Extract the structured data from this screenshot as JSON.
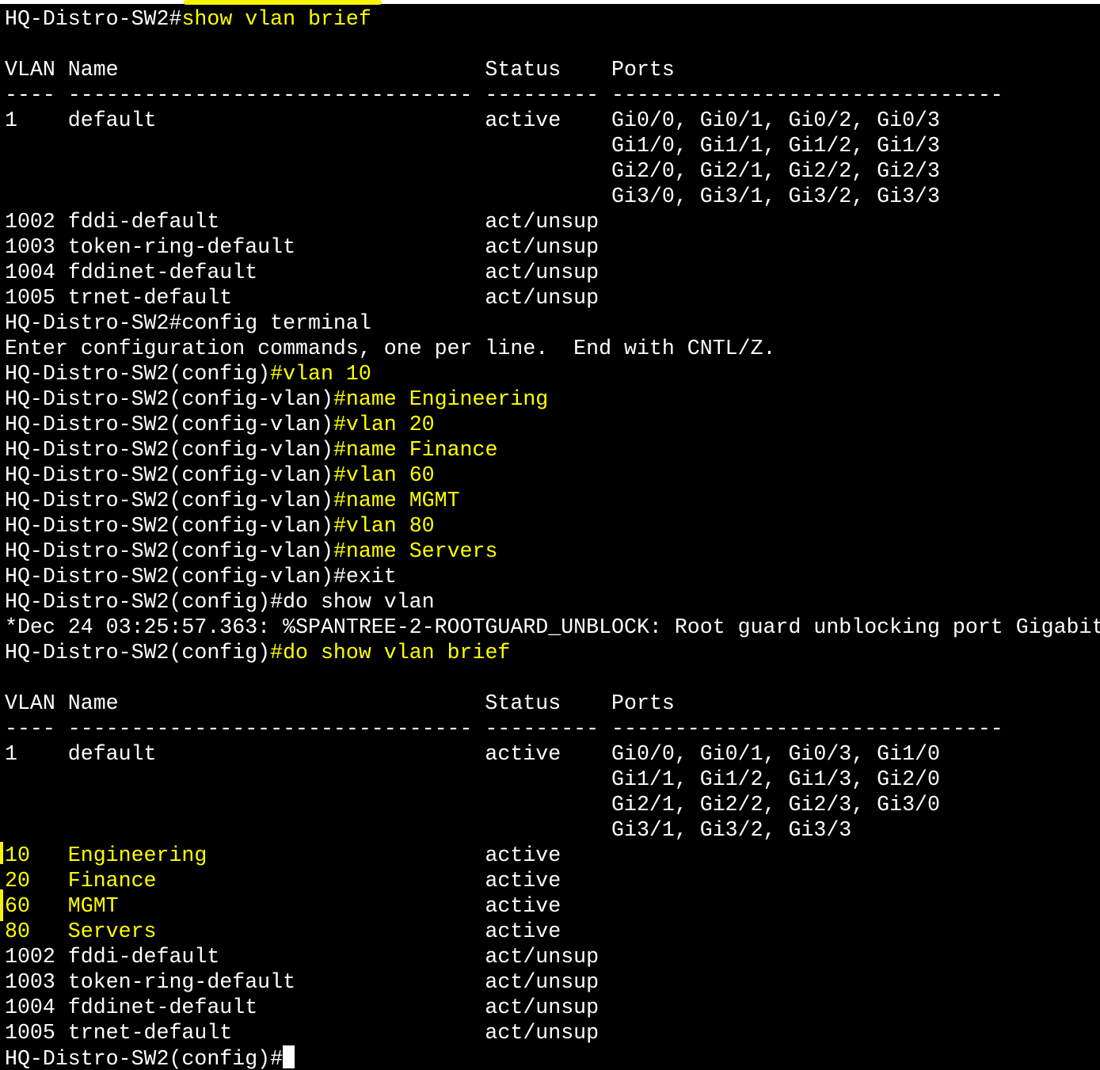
{
  "colors": {
    "background": "#000000",
    "text": "#ffffff",
    "highlight": "#ffff00",
    "annotation": "#f5f500"
  },
  "terminal": {
    "lines": [
      {
        "segments": [
          {
            "t": "HQ-Distro-SW2#",
            "c": "w"
          },
          {
            "t": "show vlan brief",
            "c": "y"
          }
        ]
      },
      {
        "segments": []
      },
      {
        "segments": [
          {
            "t": "VLAN Name                             Status    Ports",
            "c": "w"
          }
        ]
      },
      {
        "segments": [
          {
            "t": "---- -------------------------------- --------- -------------------------------",
            "c": "w"
          }
        ]
      },
      {
        "segments": [
          {
            "t": "1    default                          active    Gi0/0, Gi0/1, Gi0/2, Gi0/3",
            "c": "w"
          }
        ]
      },
      {
        "segments": [
          {
            "t": "                                                Gi1/0, Gi1/1, Gi1/2, Gi1/3",
            "c": "w"
          }
        ]
      },
      {
        "segments": [
          {
            "t": "                                                Gi2/0, Gi2/1, Gi2/2, Gi2/3",
            "c": "w"
          }
        ]
      },
      {
        "segments": [
          {
            "t": "                                                Gi3/0, Gi3/1, Gi3/2, Gi3/3",
            "c": "w"
          }
        ]
      },
      {
        "segments": [
          {
            "t": "1002 fddi-default                     act/unsup",
            "c": "w"
          }
        ]
      },
      {
        "segments": [
          {
            "t": "1003 token-ring-default               act/unsup",
            "c": "w"
          }
        ]
      },
      {
        "segments": [
          {
            "t": "1004 fddinet-default                  act/unsup",
            "c": "w"
          }
        ]
      },
      {
        "segments": [
          {
            "t": "1005 trnet-default                    act/unsup",
            "c": "w"
          }
        ]
      },
      {
        "segments": [
          {
            "t": "HQ-Distro-SW2#config terminal",
            "c": "w"
          }
        ]
      },
      {
        "segments": [
          {
            "t": "Enter configuration commands, one per line.  End with CNTL/Z.",
            "c": "w"
          }
        ]
      },
      {
        "segments": [
          {
            "t": "HQ-Distro-SW2(config)",
            "c": "w"
          },
          {
            "t": "#vlan 10",
            "c": "y"
          }
        ]
      },
      {
        "segments": [
          {
            "t": "HQ-Distro-SW2(config-vlan)",
            "c": "w"
          },
          {
            "t": "#name Engineering",
            "c": "y"
          }
        ]
      },
      {
        "segments": [
          {
            "t": "HQ-Distro-SW2(config-vlan)",
            "c": "w"
          },
          {
            "t": "#vlan 20",
            "c": "y"
          }
        ]
      },
      {
        "segments": [
          {
            "t": "HQ-Distro-SW2(config-vlan)",
            "c": "w"
          },
          {
            "t": "#name Finance",
            "c": "y"
          }
        ]
      },
      {
        "segments": [
          {
            "t": "HQ-Distro-SW2(config-vlan)",
            "c": "w"
          },
          {
            "t": "#vlan 60",
            "c": "y"
          }
        ]
      },
      {
        "segments": [
          {
            "t": "HQ-Distro-SW2(config-vlan)",
            "c": "w"
          },
          {
            "t": "#name MGMT",
            "c": "y"
          }
        ]
      },
      {
        "segments": [
          {
            "t": "HQ-Distro-SW2(config-vlan)",
            "c": "w"
          },
          {
            "t": "#vlan 80",
            "c": "y"
          }
        ]
      },
      {
        "segments": [
          {
            "t": "HQ-Distro-SW2(config-vlan)",
            "c": "w"
          },
          {
            "t": "#name Servers",
            "c": "y"
          }
        ]
      },
      {
        "segments": [
          {
            "t": "HQ-Distro-SW2(config-vlan)#exit",
            "c": "w"
          }
        ]
      },
      {
        "segments": [
          {
            "t": "HQ-Distro-SW2(config)#do show vlan",
            "c": "w"
          }
        ]
      },
      {
        "segments": [
          {
            "t": "*Dec 24 03:25:57.363: %SPANTREE-2-ROOTGUARD_UNBLOCK: Root guard unblocking port Gigabit",
            "c": "w"
          }
        ]
      },
      {
        "segments": [
          {
            "t": "HQ-Distro-SW2(config)",
            "c": "w"
          },
          {
            "t": "#do show vlan brief",
            "c": "y"
          }
        ]
      },
      {
        "segments": []
      },
      {
        "segments": [
          {
            "t": "VLAN Name                             Status    Ports",
            "c": "w"
          }
        ]
      },
      {
        "segments": [
          {
            "t": "---- -------------------------------- --------- -------------------------------",
            "c": "w"
          }
        ]
      },
      {
        "segments": [
          {
            "t": "1    default                          active    Gi0/0, Gi0/1, Gi0/3, Gi1/0",
            "c": "w"
          }
        ]
      },
      {
        "segments": [
          {
            "t": "                                                Gi1/1, Gi1/2, Gi1/3, Gi2/0",
            "c": "w"
          }
        ]
      },
      {
        "segments": [
          {
            "t": "                                                Gi2/1, Gi2/2, Gi2/3, Gi3/0",
            "c": "w"
          }
        ]
      },
      {
        "segments": [
          {
            "t": "                                                Gi3/1, Gi3/2, Gi3/3",
            "c": "w"
          }
        ]
      },
      {
        "segments": [
          {
            "t": "10   Engineering",
            "c": "y"
          },
          {
            "t": "                      active",
            "c": "w"
          }
        ]
      },
      {
        "segments": [
          {
            "t": "20   Finance",
            "c": "y"
          },
          {
            "t": "                          active",
            "c": "w"
          }
        ]
      },
      {
        "segments": [
          {
            "t": "60   MGMT",
            "c": "y"
          },
          {
            "t": "                             active",
            "c": "w"
          }
        ]
      },
      {
        "segments": [
          {
            "t": "80   Servers",
            "c": "y"
          },
          {
            "t": "                          active",
            "c": "w"
          }
        ]
      },
      {
        "segments": [
          {
            "t": "1002 fddi-default                     act/unsup",
            "c": "w"
          }
        ]
      },
      {
        "segments": [
          {
            "t": "1003 token-ring-default               act/unsup",
            "c": "w"
          }
        ]
      },
      {
        "segments": [
          {
            "t": "1004 fddinet-default                  act/unsup",
            "c": "w"
          }
        ]
      },
      {
        "segments": [
          {
            "t": "1005 trnet-default                    act/unsup",
            "c": "w"
          }
        ]
      },
      {
        "segments": [
          {
            "t": "HQ-Distro-SW2(config)#",
            "c": "w"
          }
        ],
        "cursor": true
      }
    ]
  }
}
